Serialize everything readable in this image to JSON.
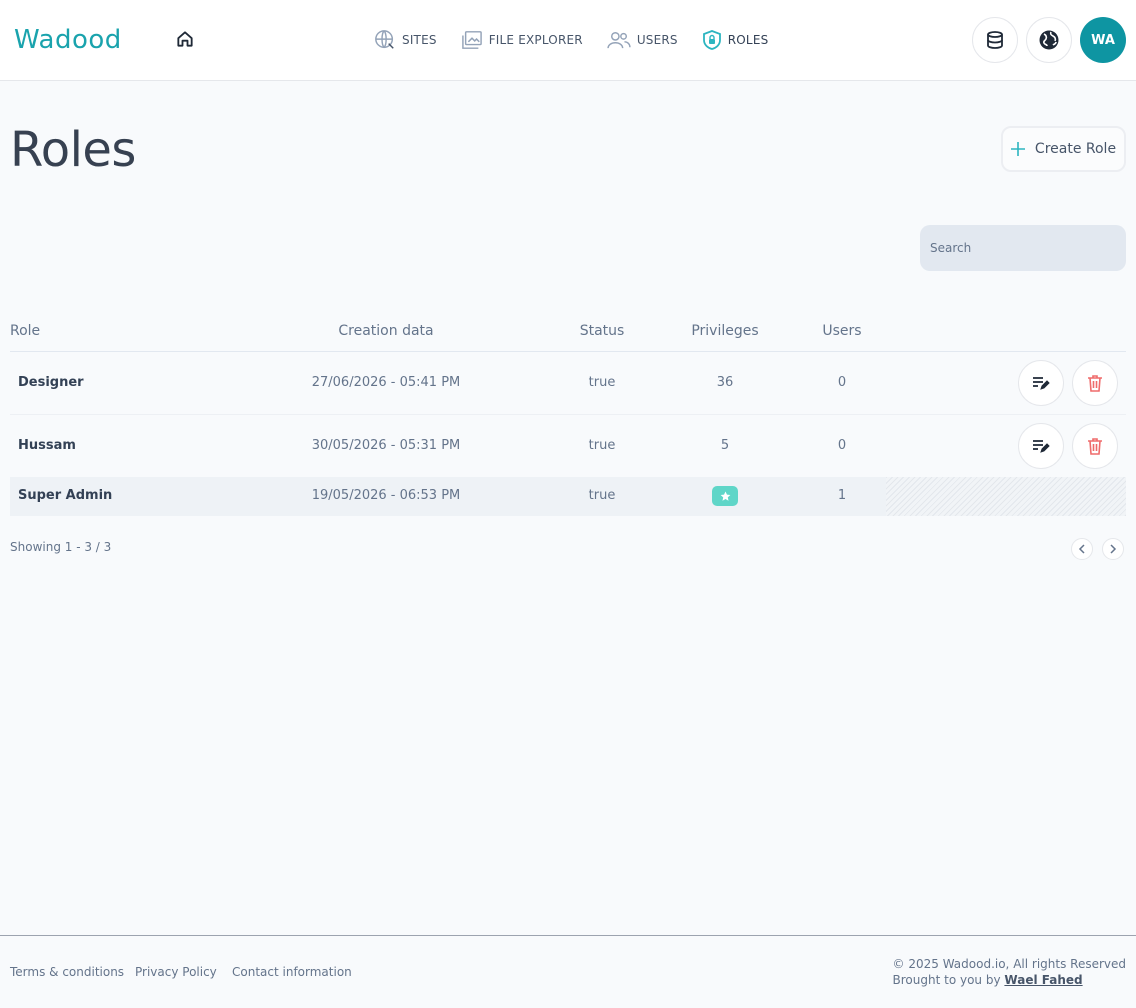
{
  "header": {
    "logo_text": "Wadood",
    "nav": [
      {
        "label": "SITES",
        "icon": "globe-icon"
      },
      {
        "label": "FILE EXPLORER",
        "icon": "folder-image-icon"
      },
      {
        "label": "USERS",
        "icon": "users-icon"
      },
      {
        "label": "ROLES",
        "icon": "shield-icon",
        "active": true
      }
    ],
    "avatar_initials": "WA",
    "colors": {
      "brand": "#0e95a2",
      "accent": "#2cb5c0"
    }
  },
  "page": {
    "title": "Roles",
    "create_label": "Create Role",
    "search_placeholder": "Search"
  },
  "table": {
    "columns": [
      "Role",
      "Creation data",
      "Status",
      "Privileges",
      "Users"
    ],
    "rows": [
      {
        "role": "Designer",
        "created": "27/06/2026 - 05:41 PM",
        "status": "true",
        "privileges": "36",
        "users": "0"
      },
      {
        "role": "Hussam",
        "created": "30/05/2026 - 05:31 PM",
        "status": "true",
        "privileges": "5",
        "users": "0"
      },
      {
        "role": "Super Admin",
        "created": "19/05/2026 - 06:53 PM",
        "status": "true",
        "privileges": "star-badge",
        "users": "1"
      }
    ],
    "showing": "Showing 1 - 3 / 3"
  },
  "footer": {
    "links": [
      "Terms & conditions",
      "Privacy Policy",
      "Contact information"
    ],
    "copyright": "© 2025 Wadood.io, All rights Reserved",
    "brought_by": "Brought to you by",
    "author": "Wael Fahed"
  }
}
